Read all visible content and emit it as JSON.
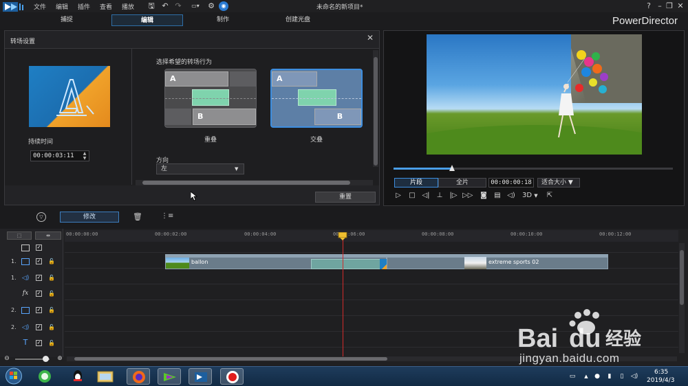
{
  "menubar": {
    "items": [
      "文件",
      "编辑",
      "插件",
      "查看",
      "播放"
    ],
    "project_title": "未命名的新项目*",
    "help_icon": "question-icon",
    "win_buttons": [
      "minimize-icon",
      "restore-icon",
      "close-icon"
    ]
  },
  "modes": {
    "tabs": [
      "捕捉",
      "编辑",
      "制作",
      "创建光盘"
    ],
    "active": "编辑",
    "brand": "PowerDirector"
  },
  "transition_panel": {
    "title": "转场设置",
    "duration_label": "持续时间",
    "duration_value": "00:00:03:11",
    "behavior_label": "选择希望的转场行为",
    "options": [
      {
        "a": "A",
        "b": "B",
        "caption": "重叠",
        "selected": false
      },
      {
        "a": "A",
        "b": "B",
        "caption": "交叠",
        "selected": true
      }
    ],
    "direction_label": "方向",
    "direction_value": "左",
    "reset_label": "重置"
  },
  "preview": {
    "segment_label": "片段",
    "full_label": "全片",
    "timecode": "00:00:00:18",
    "fit_label": "适合大小",
    "mode_3d": "3D",
    "progress": 0.21
  },
  "toolbar": {
    "modify_label": "修改"
  },
  "timeline": {
    "ticks": [
      "00:00:00:00",
      "00:00:02:00",
      "00:00:04:00",
      "00:00:06:00",
      "00:00:08:00",
      "00:00:10:00",
      "00:00:12:00"
    ],
    "tracks": [
      {
        "num": "",
        "icon": "all-tracks-icon"
      },
      {
        "num": "1.",
        "icon": "video-track-icon"
      },
      {
        "num": "1.",
        "icon": "audio-track-icon"
      },
      {
        "num": "",
        "icon": "fx-track-icon",
        "glyph": "fx"
      },
      {
        "num": "2.",
        "icon": "video-track-icon"
      },
      {
        "num": "2.",
        "icon": "audio-track-icon"
      },
      {
        "num": "",
        "icon": "title-track-icon",
        "glyph": "T"
      }
    ],
    "clips": [
      {
        "label": "ballon"
      },
      {
        "label": "extreme sports 02"
      }
    ]
  },
  "taskbar": {
    "time": "6:35",
    "date": "2019/4/3"
  },
  "watermark": {
    "text": "Bai 经验",
    "url": "jingyan.baidu.com"
  }
}
